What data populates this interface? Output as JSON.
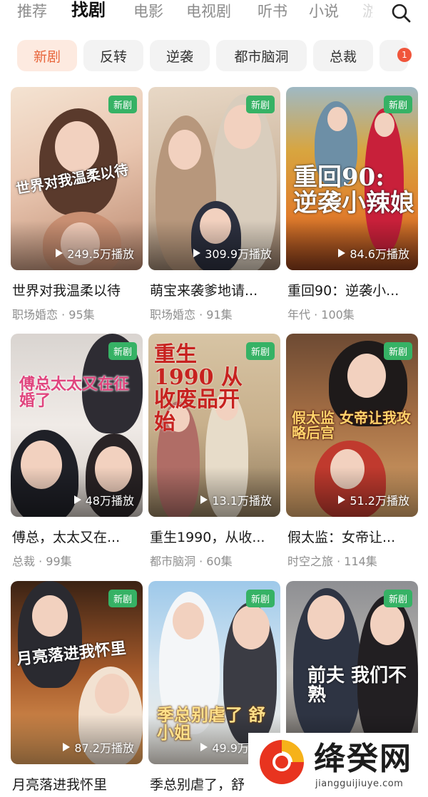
{
  "top_tabs": [
    {
      "label": "推荐"
    },
    {
      "label": "找剧"
    },
    {
      "label": "电影"
    },
    {
      "label": "电视剧"
    },
    {
      "label": "听书"
    },
    {
      "label": "小说"
    },
    {
      "label": "游"
    }
  ],
  "chips": [
    {
      "label": "新剧"
    },
    {
      "label": "反转"
    },
    {
      "label": "逆袭"
    },
    {
      "label": "都市脑洞"
    },
    {
      "label": "总裁"
    },
    {
      "label": ""
    }
  ],
  "chip_badge": "1",
  "new_tag": "新剧",
  "dramas": [
    {
      "title": "世界对我温柔以待",
      "meta": "职场婚恋 · 95集",
      "plays": "249.5万播放",
      "poster_text": "世界对我温柔以待"
    },
    {
      "title": "萌宝来袭爹地请...",
      "meta": "职场婚恋 · 91集",
      "plays": "309.9万播放",
      "poster_text": ""
    },
    {
      "title": "重回90：逆袭小...",
      "meta": "年代 · 100集",
      "plays": "84.6万播放",
      "poster_text": "重回90: 逆袭小辣娘"
    },
    {
      "title": "傅总，太太又在...",
      "meta": "总裁 · 99集",
      "plays": "48万播放",
      "poster_text": "傅总太太又在征婚了"
    },
    {
      "title": "重生1990，从收...",
      "meta": "都市脑洞 · 60集",
      "plays": "13.1万播放",
      "poster_text": "重生1990 从收废品开始"
    },
    {
      "title": "假太监：女帝让...",
      "meta": "时空之旅 · 114集",
      "plays": "51.2万播放",
      "poster_text": "假太监 女帝让我攻略后宫"
    },
    {
      "title": "月亮落进我怀里",
      "meta": "",
      "plays": "87.2万播放",
      "poster_text": "月亮落进我怀里"
    },
    {
      "title": "季总别虐了，舒",
      "meta": "",
      "plays": "49.9万播放",
      "poster_text": "季总别虐了 舒小姐"
    },
    {
      "title": "",
      "meta": "",
      "plays": "",
      "poster_text": "前夫 我们不熟"
    }
  ],
  "watermark": {
    "text": "绛癸网",
    "url": "jiangguijiuye.com"
  },
  "colors": {
    "accent": "#e8663c",
    "new_tag": "#36b265",
    "badge": "#f0553b"
  }
}
